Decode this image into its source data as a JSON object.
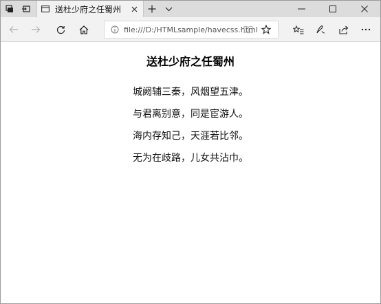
{
  "browser": {
    "tab": {
      "title": "送杜少府之任蜀州"
    },
    "address_bar": {
      "url": "file:///D:/HTMLsample/havecss.html"
    }
  },
  "page": {
    "title": "送杜少府之任蜀州",
    "lines": [
      "城阙辅三秦，风烟望五津。",
      "与君离别意，同是宦游人。",
      "海内存知己，天涯若比邻。",
      "无为在歧路，儿女共沾巾。"
    ]
  },
  "icons": {
    "tab_actions": "tab-actions-icon",
    "set_aside": "set-aside-tabs-icon",
    "tab_favicon": "page-icon",
    "tab_close": "close-icon",
    "new_tab": "plus-icon",
    "tab_preview": "chevron-down-icon",
    "back": "arrow-left-icon",
    "forward": "arrow-right-icon",
    "refresh": "refresh-icon",
    "home": "home-icon",
    "site_info": "info-icon",
    "reading_view": "book-icon",
    "favorite": "star-icon",
    "favorites_hub": "favorites-list-icon",
    "notes": "pen-icon",
    "share": "share-icon",
    "more": "more-icon"
  }
}
